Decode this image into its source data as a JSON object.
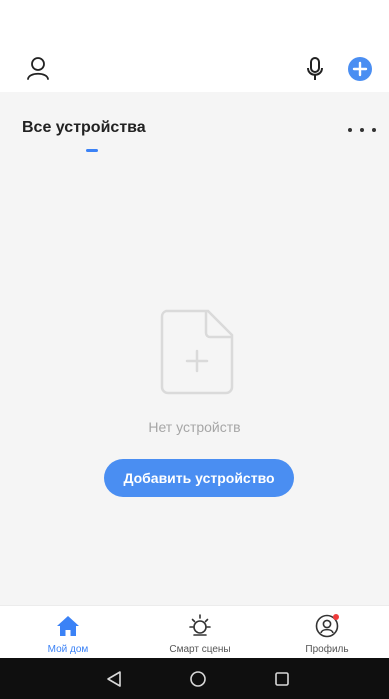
{
  "header": {
    "icons": {
      "avatar": "person-icon",
      "mic": "microphone-icon",
      "add": "plus-circle-icon"
    },
    "accent_color": "#4a8ef2"
  },
  "section": {
    "title": "Все устройства",
    "more_icon": "more-horizontal-icon"
  },
  "empty_state": {
    "icon": "document-plus-icon",
    "message": "Нет устройств",
    "button_label": "Добавить устройство"
  },
  "tabbar": {
    "tabs": [
      {
        "label": "Мой дом",
        "icon": "home-icon",
        "active": true
      },
      {
        "label": "Смарт сцены",
        "icon": "sun-icon",
        "active": false
      },
      {
        "label": "Профиль",
        "icon": "profile-icon",
        "active": false,
        "has_notification": true
      }
    ]
  },
  "system_nav": {
    "icons": [
      "back-triangle-icon",
      "home-circle-icon",
      "recent-square-icon"
    ]
  }
}
